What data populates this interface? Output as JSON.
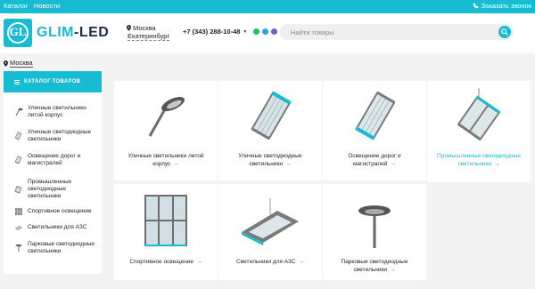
{
  "topbar": {
    "links": [
      "Каталог",
      "Новости"
    ],
    "callback": "Заказать звонок"
  },
  "header": {
    "logo_letters": "GL",
    "logo_part1": "GLIM",
    "logo_part2": "-LED",
    "city1": "Москва",
    "city2": "Екатеринбург",
    "phone": "+7 (343) 288-10-48",
    "search_placeholder": "Найти товары"
  },
  "location": "Москва",
  "sidebar": {
    "catalog_label": "КАТАЛОГ ТОВАРОВ",
    "items": [
      {
        "label": "Уличные светильники литой корпус",
        "icon": "street-light-icon"
      },
      {
        "label": "Уличные светодиодные светильники",
        "icon": "led-panel-icon"
      },
      {
        "label": "Освещение дорог и магистралей",
        "icon": "road-light-icon"
      },
      {
        "label": "Промышленные светодиодные светильники",
        "icon": "industrial-light-icon"
      },
      {
        "label": "Спортивное освещение",
        "icon": "sport-light-icon"
      },
      {
        "label": "Светильники для АЗС",
        "icon": "gas-station-light-icon"
      },
      {
        "label": "Парковые светодиодные светильники",
        "icon": "park-light-icon"
      }
    ]
  },
  "products": [
    {
      "name": "Уличные светильники литой корпус"
    },
    {
      "name": "Уличные светодиодные светильники"
    },
    {
      "name": "Освещение дорог и магистралей"
    },
    {
      "name": "Промышленные светодиодные светильники"
    },
    {
      "name": "Спортивное освещение"
    },
    {
      "name": "Светильники для АЗС"
    },
    {
      "name": "Парковые светодиодные светильники"
    }
  ],
  "arrow": "→",
  "colors": {
    "accent": "#17bcd2",
    "brand_dark": "#1c2c44"
  }
}
